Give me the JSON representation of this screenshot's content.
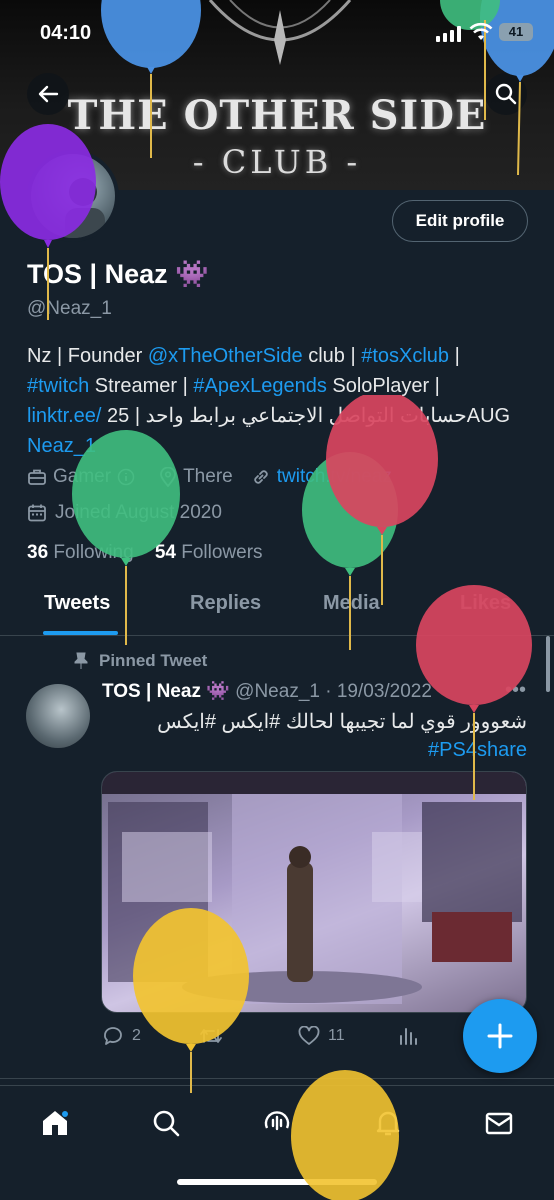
{
  "status_bar": {
    "time": "04:10",
    "battery": "41"
  },
  "banner": {
    "title": "THE OTHER SIDE",
    "subtitle": "- CLUB -"
  },
  "profile": {
    "edit_label": "Edit profile",
    "name": "TOS | Neaz",
    "name_emoji": "👾",
    "handle": "@Neaz_1",
    "bio": {
      "l1_a": "Nz | Founder ",
      "l1_link1": "@xTheOtherSide",
      "l1_b": " club | ",
      "l1_link2": "#tosXclub",
      "l1_c": " |",
      "l2_link1": "#twitch",
      "l2_a": " Streamer | ",
      "l2_link2": "#ApexLegends",
      "l2_b": " SoloPlayer |",
      "l3_link": "linktr.ee/",
      "l3_text": " حسابات التواصل الاجتماعي برابط واحد | 25AUG",
      "l4_link": "Neaz_1"
    },
    "category": "Gamer",
    "location": "There",
    "website": "twitch.tv/neaz",
    "joined": "Joined August 2020",
    "following_count": "36",
    "following_label": "Following",
    "followers_count": "54",
    "followers_label": "Followers"
  },
  "tabs": [
    "Tweets",
    "Replies",
    "Media",
    "Likes"
  ],
  "tweet": {
    "pinned_label": "Pinned Tweet",
    "author": "TOS | Neaz 👾",
    "handle_date": "@Neaz_1 · 19/03/2022",
    "text_rtl": "شعووور قوي لما تجيبها لحالك #ايكس #ايكس",
    "text_tag": "#PS4share",
    "replies": "2",
    "likes": "11"
  },
  "colors": {
    "background": "#15202b",
    "accent": "#1d9bf0",
    "muted": "#8b98a5"
  },
  "icons": [
    "back-arrow-icon",
    "search-icon",
    "briefcase-icon",
    "location-pin-icon",
    "link-icon",
    "calendar-icon",
    "pin-icon",
    "reply-icon",
    "retweet-icon",
    "heart-icon",
    "analytics-icon",
    "plus-icon",
    "home-icon",
    "explore-icon",
    "spaces-icon",
    "notifications-icon",
    "messages-icon"
  ]
}
